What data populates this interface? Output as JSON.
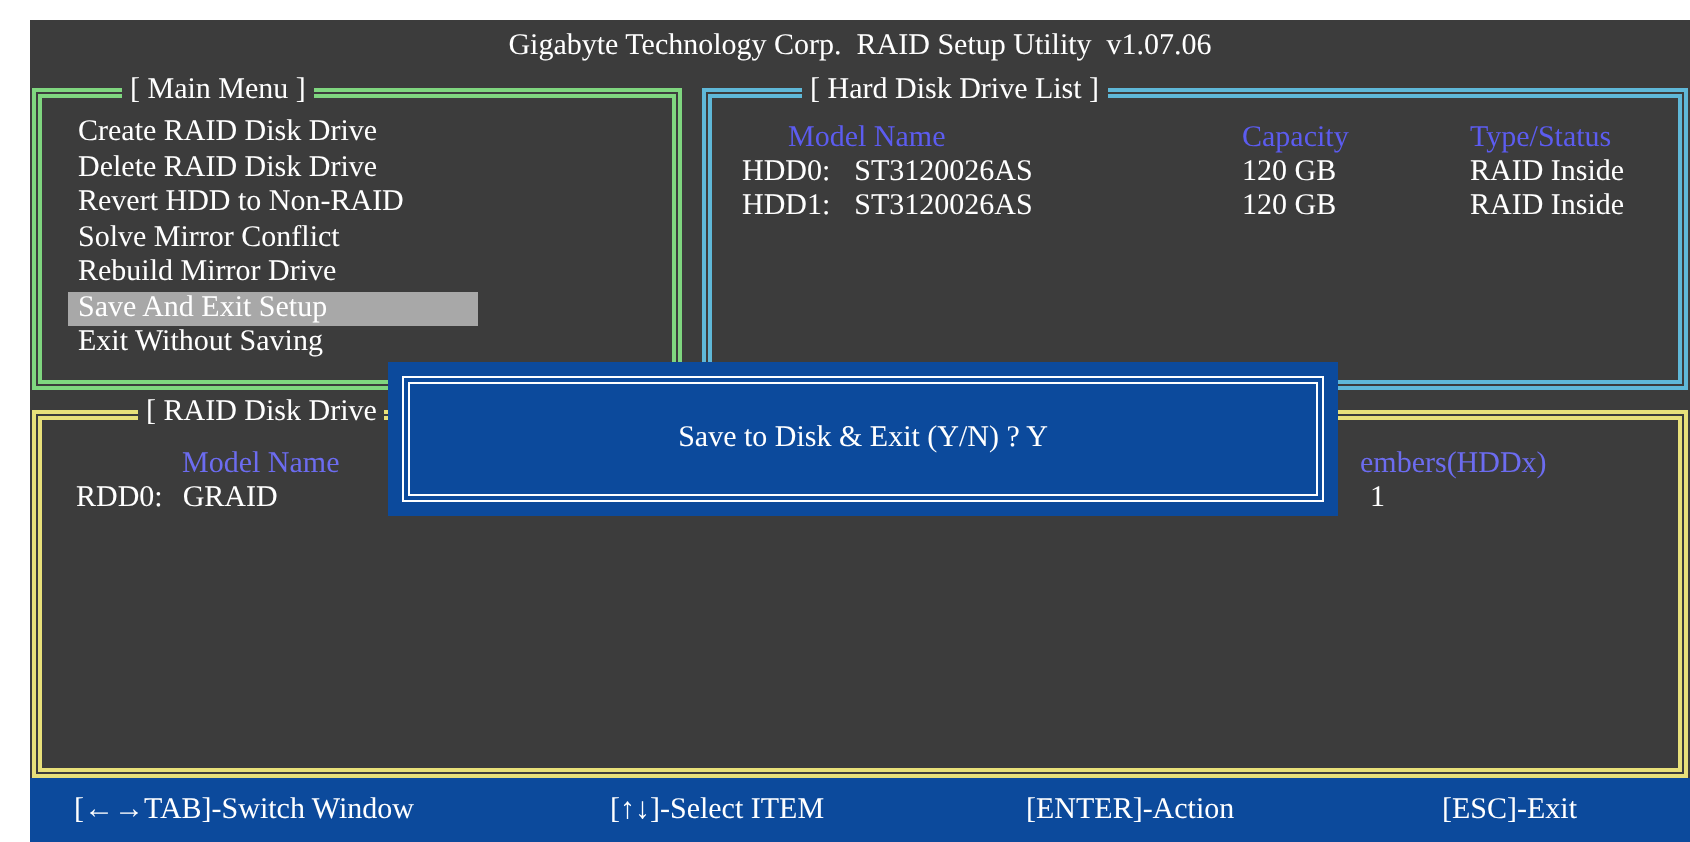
{
  "title": "Gigabyte Technology Corp.  RAID Setup Utility  v1.07.06",
  "main_menu": {
    "title": "[ Main Menu ]",
    "items": [
      {
        "label": "Create RAID Disk Drive",
        "selected": false
      },
      {
        "label": "Delete RAID Disk Drive",
        "selected": false
      },
      {
        "label": "Revert HDD to Non-RAID",
        "selected": false
      },
      {
        "label": "Solve Mirror Conflict",
        "selected": false
      },
      {
        "label": "Rebuild Mirror Drive",
        "selected": false
      },
      {
        "label": "Save And Exit Setup",
        "selected": true
      },
      {
        "label": "Exit Without Saving",
        "selected": false
      }
    ]
  },
  "hdd_list": {
    "title": "[ Hard Disk Drive List ]",
    "columns": [
      "Model Name",
      "Capacity",
      "Type/Status"
    ],
    "rows": [
      {
        "id": "HDD0:",
        "model": "ST3120026AS",
        "capacity": "120 GB",
        "status": "RAID Inside"
      },
      {
        "id": "HDD1:",
        "model": "ST3120026AS",
        "capacity": "120 GB",
        "status": "RAID Inside"
      }
    ]
  },
  "raid_list": {
    "title": "[ RAID Disk Drive",
    "columns": [
      "Model Name",
      "embers(HDDx)"
    ],
    "rows": [
      {
        "id": "RDD0:",
        "model": "GRAID",
        "members": "1"
      }
    ]
  },
  "dialog": {
    "text": "Save to Disk & Exit (Y/N) ? Y"
  },
  "footer": [
    "[←→TAB]-Switch Window",
    "[↑↓]-Select ITEM",
    "[ENTER]-Action",
    "[ESC]-Exit"
  ]
}
